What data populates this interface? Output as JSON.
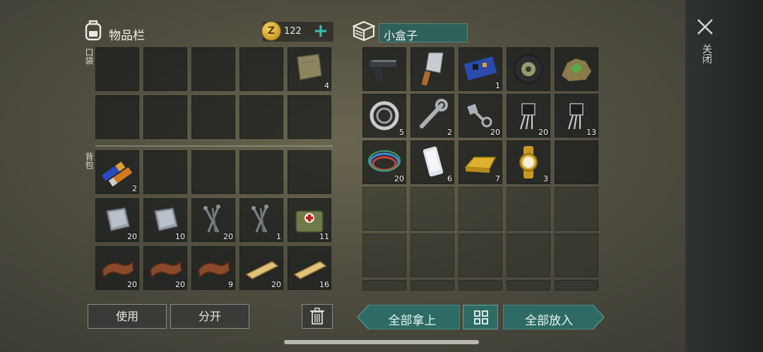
{
  "inventory": {
    "title": "物品栏",
    "currency": {
      "symbol": "Z",
      "amount": "122",
      "add_icon": "plus-icon"
    },
    "pocket_label": "口袋",
    "backpack_label": "背包",
    "pocket_items": [
      {
        "icon": "cloth-icon",
        "count": "4"
      }
    ],
    "backpack_items": [
      {
        "icon": "battery-icon",
        "count": "2"
      },
      {
        "icon": "scrap-metal-icon",
        "count": "20"
      },
      {
        "icon": "scrap-metal-icon",
        "count": "10"
      },
      {
        "icon": "nails-icon",
        "count": "20"
      },
      {
        "icon": "nails-icon",
        "count": "1"
      },
      {
        "icon": "medkit-bag-icon",
        "count": "11"
      },
      {
        "icon": "leather-icon",
        "count": "20"
      },
      {
        "icon": "leather-icon",
        "count": "20"
      },
      {
        "icon": "leather-icon",
        "count": "9"
      },
      {
        "icon": "wood-plank-icon",
        "count": "20"
      },
      {
        "icon": "wood-plank-icon",
        "count": "16"
      }
    ],
    "use_button": "使用",
    "split_button": "分开",
    "trash_icon": "trash-icon"
  },
  "container": {
    "title": "小盒子",
    "items": [
      {
        "icon": "pistol-icon",
        "count": ""
      },
      {
        "icon": "cleaver-icon",
        "count": ""
      },
      {
        "icon": "circuit-board-icon",
        "count": "1"
      },
      {
        "icon": "tire-icon",
        "count": ""
      },
      {
        "icon": "ore-icon",
        "count": ""
      },
      {
        "icon": "bearing-icon",
        "count": "5"
      },
      {
        "icon": "wrench-icon",
        "count": "2"
      },
      {
        "icon": "bolt-icon",
        "count": "20"
      },
      {
        "icon": "transistor-icon",
        "count": "20"
      },
      {
        "icon": "transistor-icon",
        "count": "13"
      },
      {
        "icon": "wires-icon",
        "count": "20"
      },
      {
        "icon": "phone-icon",
        "count": "6"
      },
      {
        "icon": "gold-bar-icon",
        "count": "7"
      },
      {
        "icon": "gold-watch-icon",
        "count": "3"
      }
    ],
    "take_all_button": "全部拿上",
    "put_all_button": "全部放入",
    "sort_icon": "grid-icon"
  },
  "close": {
    "label": "关闭",
    "icon": "close-icon"
  }
}
